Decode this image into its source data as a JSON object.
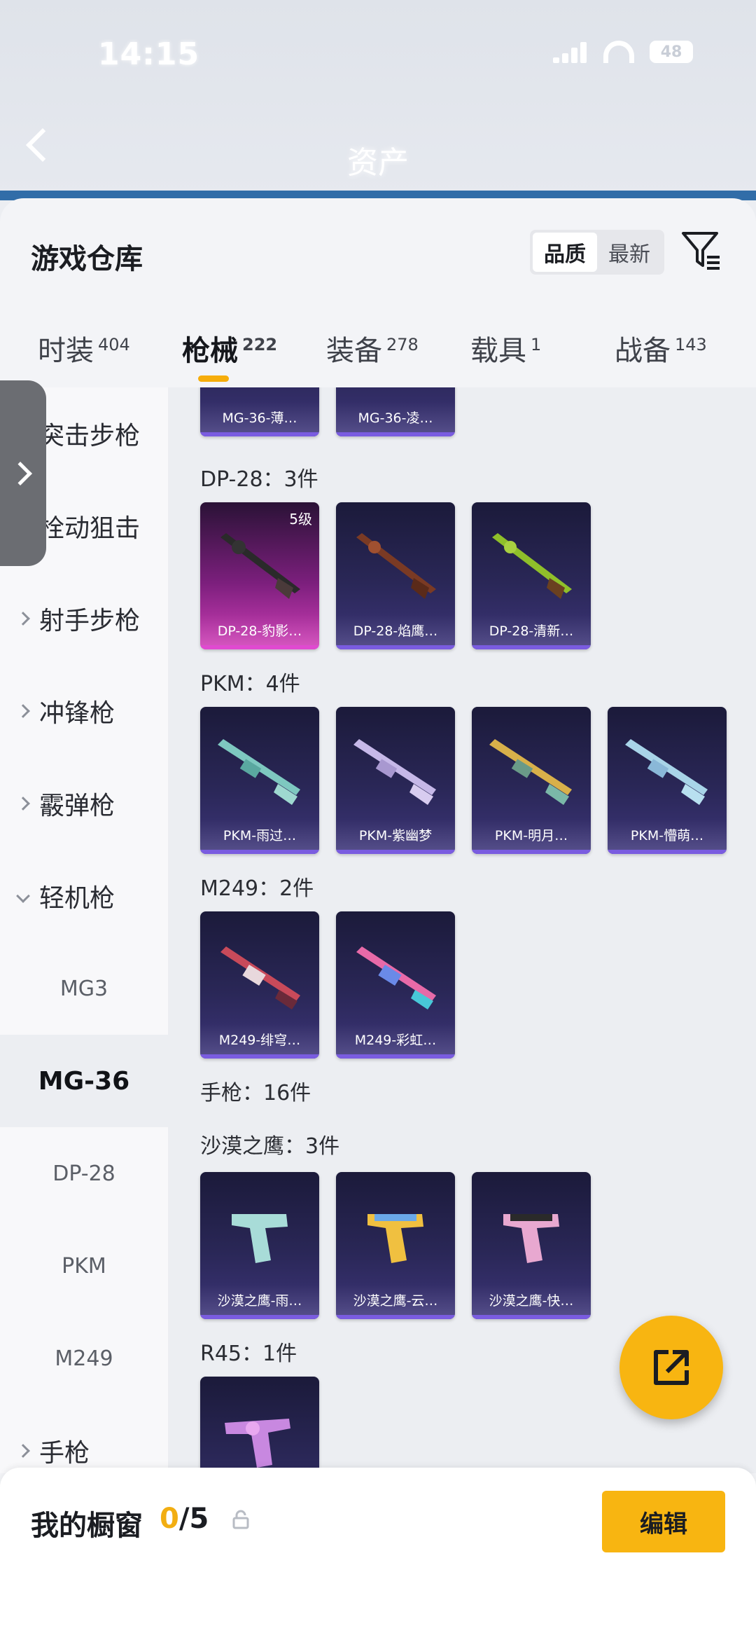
{
  "status": {
    "time": "14:15",
    "battery": "48"
  },
  "nav": {
    "title": "资产"
  },
  "header": {
    "title": "游戏仓库",
    "sort": [
      "品质",
      "最新"
    ],
    "sort_active": 0
  },
  "tabs": [
    {
      "label": "时装",
      "count": "404"
    },
    {
      "label": "枪械",
      "count": "222"
    },
    {
      "label": "装备",
      "count": "278"
    },
    {
      "label": "载具",
      "count": "1"
    },
    {
      "label": "战备",
      "count": "143"
    }
  ],
  "active_tab": 1,
  "categories": [
    {
      "label": "突击步枪"
    },
    {
      "label": "栓动狙击"
    },
    {
      "label": "射手步枪"
    },
    {
      "label": "冲锋枪"
    },
    {
      "label": "霰弹枪"
    },
    {
      "label": "轻机枪"
    },
    {
      "label": "MG3"
    },
    {
      "label": "MG-36"
    },
    {
      "label": "DP-28"
    },
    {
      "label": "PKM"
    },
    {
      "label": "M249"
    },
    {
      "label": "手枪"
    }
  ],
  "sections": {
    "mg36": {
      "items": [
        "MG-36-薄…",
        "MG-36-凌…"
      ]
    },
    "dp28": {
      "title": "DP-28：3件",
      "level": "5级",
      "items": [
        "DP-28-豹影…",
        "DP-28-焰鹰…",
        "DP-28-清新…"
      ]
    },
    "pkm": {
      "title": "PKM：4件",
      "items": [
        "PKM-雨过…",
        "PKM-紫幽梦",
        "PKM-明月…",
        "PKM-懵萌…"
      ]
    },
    "m249": {
      "title": "M249：2件",
      "items": [
        "M249-绯穹…",
        "M249-彩虹…"
      ]
    },
    "pistol": {
      "title": "手枪：16件"
    },
    "deagle": {
      "title": "沙漠之鹰：3件",
      "items": [
        "沙漠之鹰-雨…",
        "沙漠之鹰-云…",
        "沙漠之鹰-快…"
      ]
    },
    "r45": {
      "title": "R45：1件"
    }
  },
  "showcase": {
    "label": "我的橱窗",
    "current": "0",
    "total": "/5",
    "edit": "编辑"
  },
  "colors": {
    "accent": "#f8b511",
    "card_bg": "#2a2757",
    "card_pink": "#d23fb8"
  }
}
